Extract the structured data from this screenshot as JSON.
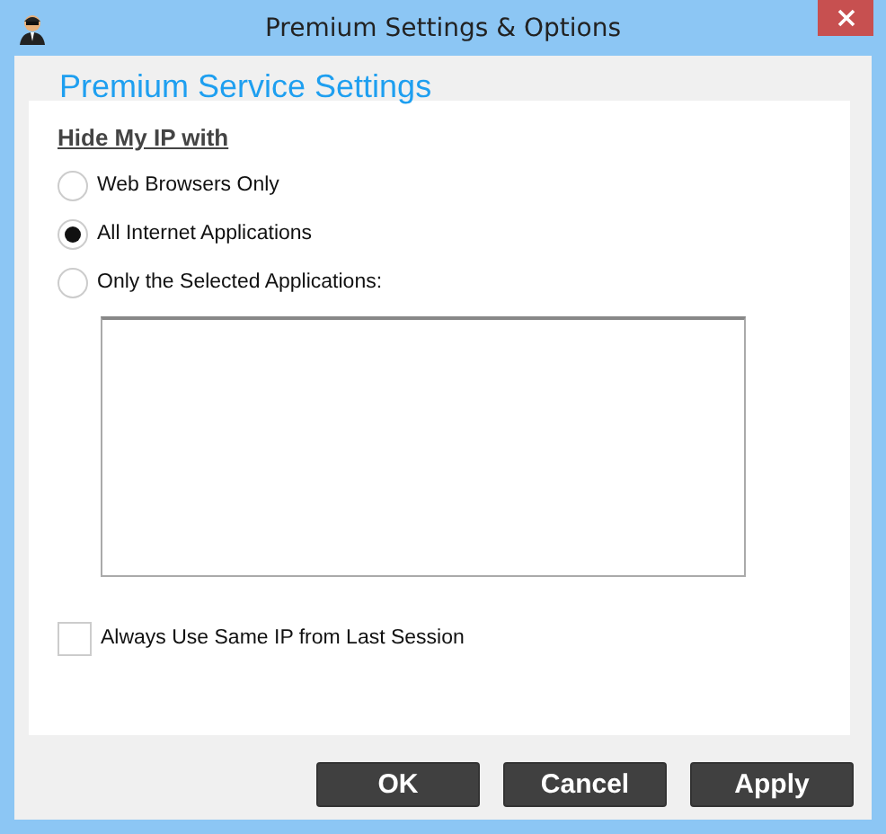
{
  "window": {
    "title": "Premium Settings & Options"
  },
  "heading": "Premium Service Settings",
  "group_label": "Hide My IP with",
  "options": [
    {
      "label": "Web Browsers Only",
      "selected": false
    },
    {
      "label": "All Internet Applications",
      "selected": true
    },
    {
      "label": "Only the Selected Applications:",
      "selected": false
    }
  ],
  "checkbox": {
    "label": "Always Use Same IP from Last Session",
    "checked": false
  },
  "buttons": [
    "OK",
    "Cancel",
    "Apply"
  ]
}
